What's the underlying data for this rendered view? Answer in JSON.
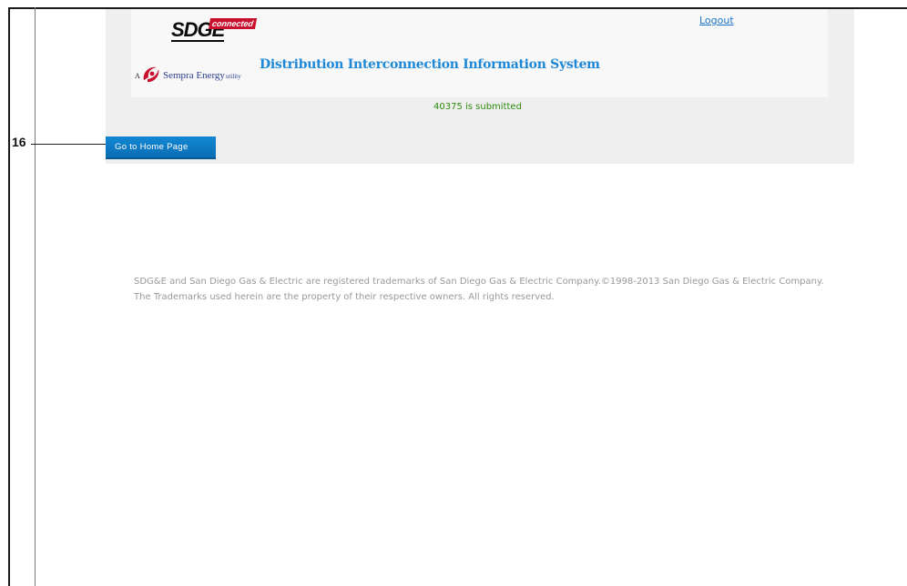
{
  "annotation": {
    "callout_number": "16"
  },
  "header": {
    "logo": {
      "brand": "SDGE",
      "tag": "connected",
      "sempra_prefix": "A",
      "sempra_name": "Sempra Energy",
      "sempra_suffix": "utility"
    },
    "system_title": "Distribution Interconnection Information System",
    "logout_label": "Logout"
  },
  "status": {
    "message": "40375 is submitted"
  },
  "actions": {
    "home_button_label": "Go to Home Page"
  },
  "footer": {
    "line1": "SDG&E and San Diego Gas & Electric are registered trademarks of San Diego Gas & Electric Company.©1998-2013 San Diego Gas & Electric Company.",
    "line2": "The Trademarks used herein are the property of their respective owners. All rights reserved."
  },
  "colors": {
    "title": "#1e88d6",
    "status": "#2e8b0e",
    "button": "#0a6eb4",
    "link": "#1a73c9",
    "footer_text": "#999999"
  }
}
